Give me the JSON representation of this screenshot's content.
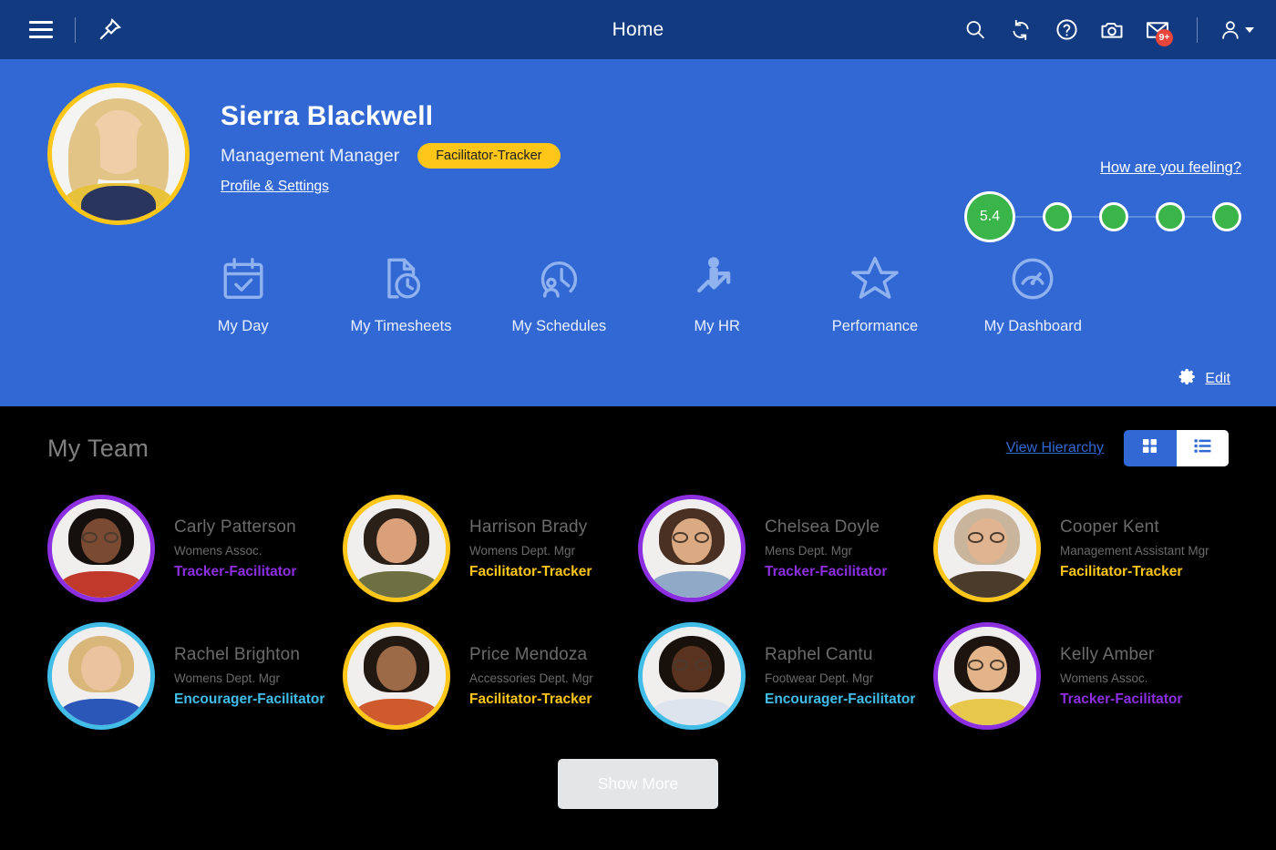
{
  "topbar": {
    "title": "Home",
    "menu_icon": "hamburger-menu-icon",
    "pin_icon": "pin-icon",
    "icons": [
      {
        "name": "search-icon",
        "label": "Search"
      },
      {
        "name": "refresh-icon",
        "label": "Refresh"
      },
      {
        "name": "help-icon",
        "label": "Help"
      },
      {
        "name": "camera-icon",
        "label": "Camera"
      },
      {
        "name": "mail-icon",
        "label": "Messages"
      }
    ],
    "mail_badge": "9+",
    "user_icon": "user-account-icon"
  },
  "profile": {
    "name": "Sierra Blackwell",
    "role": "Management Manager",
    "pill": "Facilitator-Tracker",
    "settings_link": "Profile & Settings",
    "avatar_ring_color": "#ffc61a"
  },
  "feeling": {
    "link": "How are you feeling?",
    "score": "5.4",
    "dot_color": "#3ab54a",
    "dot_count": 5
  },
  "quicknav": [
    {
      "label": "My Day",
      "icon": "calendar-check-icon"
    },
    {
      "label": "My Timesheets",
      "icon": "document-clock-icon"
    },
    {
      "label": "My Schedules",
      "icon": "person-clock-icon"
    },
    {
      "label": "My HR",
      "icon": "person-growth-arrow-icon"
    },
    {
      "label": "Performance",
      "icon": "star-icon"
    },
    {
      "label": "My Dashboard",
      "icon": "gauge-icon"
    }
  ],
  "edit": {
    "label": "Edit",
    "icon": "gear-icon"
  },
  "team": {
    "title": "My Team",
    "hierarchy_link": "View Hierarchy",
    "view_grid_icon": "grid-view-icon",
    "view_list_icon": "list-view-icon",
    "active_view": "list",
    "show_more": "Show More",
    "members": [
      {
        "name": "Carly Patterson",
        "dept": "Womens Assoc.",
        "role": "Tracker-Facilitator",
        "color": "#8b2fe0",
        "skin": "#7a4a32",
        "hair": "#15100d",
        "shirt": "#c0392b",
        "glasses": true
      },
      {
        "name": "Harrison Brady",
        "dept": "Womens Dept. Mgr",
        "role": "Facilitator-Tracker",
        "color": "#ffc61a",
        "skin": "#d9a07a",
        "hair": "#2b2018",
        "shirt": "#6e7042",
        "glasses": false
      },
      {
        "name": "Chelsea Doyle",
        "dept": "Mens Dept. Mgr",
        "role": "Tracker-Facilitator",
        "color": "#8b2fe0",
        "skin": "#dba982",
        "hair": "#4a3022",
        "shirt": "#8fa9c6",
        "glasses": true
      },
      {
        "name": "Cooper Kent",
        "dept": "Management Assistant Mgr",
        "role": "Facilitator-Tracker",
        "color": "#ffc61a",
        "skin": "#e0b490",
        "hair": "#c9b49c",
        "shirt": "#4b3b2b",
        "glasses": true
      },
      {
        "name": "Rachel Brighton",
        "dept": "Womens Dept. Mgr",
        "role": "Encourager-Facilitator",
        "color": "#41bde8",
        "skin": "#ebc39e",
        "hair": "#d9b679",
        "shirt": "#2b57b8",
        "glasses": false
      },
      {
        "name": "Price Mendoza",
        "dept": "Accessories Dept. Mgr",
        "role": "Facilitator-Tracker",
        "color": "#ffc61a",
        "skin": "#9c6a46",
        "hair": "#221812",
        "shirt": "#cf5b2c",
        "glasses": false
      },
      {
        "name": "Raphel Cantu",
        "dept": "Footwear Dept. Mgr",
        "role": "Encourager-Facilitator",
        "color": "#41bde8",
        "skin": "#59331f",
        "hair": "#17100b",
        "shirt": "#dde4ee",
        "glasses": true
      },
      {
        "name": "Kelly Amber",
        "dept": "Womens Assoc.",
        "role": "Tracker-Facilitator",
        "color": "#8b2fe0",
        "skin": "#e3b489",
        "hair": "#1d1410",
        "shirt": "#e8c84a",
        "glasses": true
      }
    ]
  },
  "colors": {
    "topbar": "#123a80",
    "hero": "#3268d4",
    "accent_yellow": "#ffc61a",
    "accent_purple": "#8b2fe0",
    "accent_cyan": "#41bde8",
    "link_blue": "#3268d4",
    "team_bg": "#000000"
  }
}
